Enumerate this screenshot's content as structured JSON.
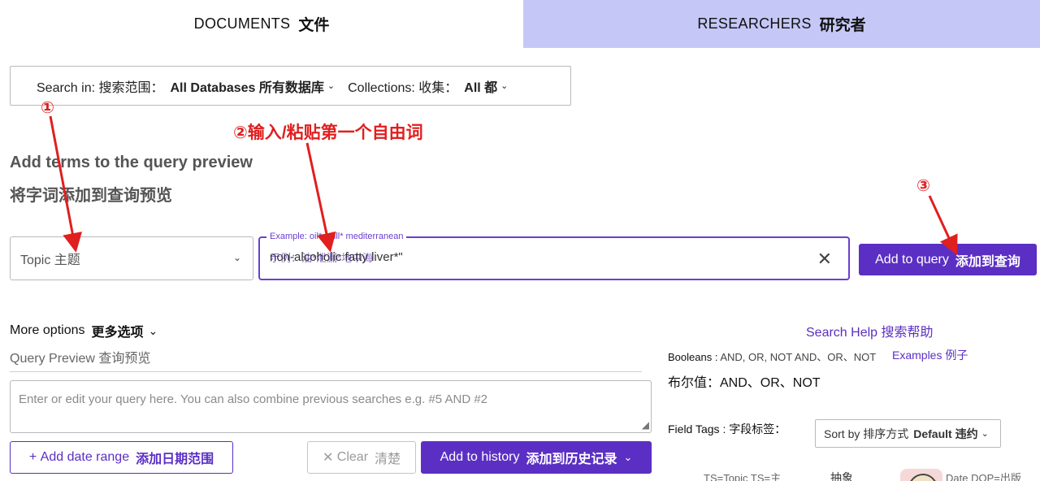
{
  "tabs": {
    "documents": {
      "en": "DOCUMENTS",
      "zh": "文件"
    },
    "researchers": {
      "en": "RESEARCHERS",
      "zh": "研究者"
    }
  },
  "search_in": {
    "label": "Search in: 搜索范围：",
    "value": "All Databases 所有数据库",
    "collections_label": "Collections: 收集：",
    "collections_value": "All 都"
  },
  "heading": {
    "en": "Add terms to the query preview",
    "zh": "将字词添加到查询预览"
  },
  "topic_select": {
    "value": "Topic 主题"
  },
  "term_input": {
    "legend": "Example: oil* spill* mediterranean",
    "value": "non-alcoholic fatty liver*\"",
    "ghost": "示例：油*泄漏*地中海"
  },
  "add_query_button": {
    "en": "Add to query",
    "zh": "添加到查询"
  },
  "annotations": {
    "step1": "①",
    "step2": "②输入/粘贴第一个自由词",
    "step3": "③"
  },
  "more_options": {
    "en": "More options",
    "zh": "更多选项"
  },
  "query_preview": {
    "label": "Query Preview 查询预览",
    "placeholder": "Enter or edit your query here. You can also combine previous searches e.g. #5 AND #2"
  },
  "buttons": {
    "add_date": {
      "en": "Add date range",
      "zh": "添加日期范围"
    },
    "clear": {
      "en": "Clear",
      "zh": "清楚"
    },
    "add_history": {
      "en": "Add to history",
      "zh": "添加到历史记录"
    }
  },
  "help": {
    "search_help": "Search Help 搜索帮助",
    "booleans_label": "Booleans : ",
    "booleans_ops": "AND, OR, NOT AND、OR、NOT",
    "examples": "Examples 例子",
    "booleans_zh": "布尔值：AND、OR、NOT",
    "field_tags": "Field Tags : 字段标签："
  },
  "sort": {
    "label": "Sort by 排序方式",
    "value": "Default 违约"
  },
  "cut_row": {
    "tag": "TS=Topic  TS=主",
    "abstract": "抽象",
    "dop": "Date  DOP=出版"
  },
  "colors": {
    "accent": "#5b2fc4",
    "researchers_tab_bg": "#c5c8f7",
    "annotation": "#e01f1f"
  }
}
